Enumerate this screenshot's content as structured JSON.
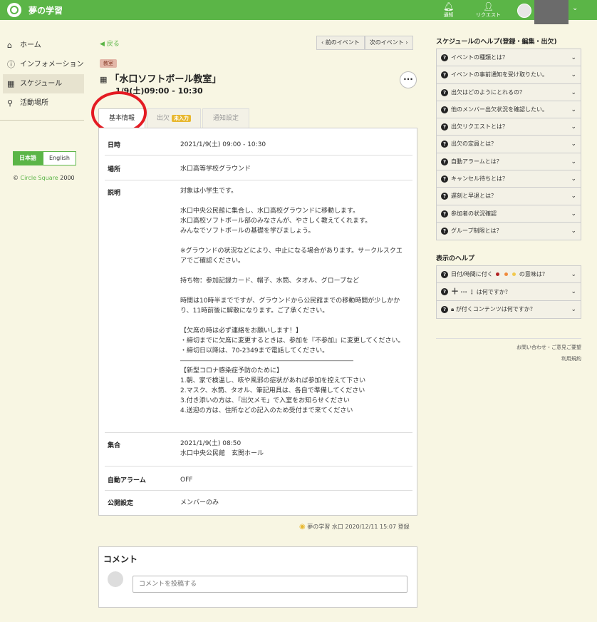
{
  "header": {
    "app_title": "夢の学習",
    "notify_label": "通知",
    "request_label": "リクエスト"
  },
  "sidebar": {
    "items": [
      {
        "label": "ホーム",
        "icon": "home-icon"
      },
      {
        "label": "インフォメーション",
        "icon": "info-icon"
      },
      {
        "label": "スケジュール",
        "icon": "calendar-icon"
      },
      {
        "label": "活動場所",
        "icon": "map-pin-icon"
      }
    ],
    "lang_ja": "日本語",
    "lang_en": "English",
    "copyright_symbol": "©",
    "copyright_brand": "Circle Square",
    "copyright_year": "2000"
  },
  "main": {
    "back_label": "戻る",
    "prev_event": "前のイベント",
    "next_event": "次のイベント",
    "category_badge": "教室",
    "title": "「水口ソフトボール教室」",
    "datetime": "1/9(土)09:00 - 10:30",
    "tabs": {
      "basic": "基本情報",
      "attendance": "出欠",
      "attendance_badge": "未入力",
      "notify": "通知設定"
    },
    "rows": [
      {
        "key": "日時",
        "value": "2021/1/9(土) 09:00 - 10:30"
      },
      {
        "key": "場所",
        "value": "水口高等学校グラウンド"
      },
      {
        "key": "説明",
        "value": "対象は小学生です。\n\n水口中央公民館に集合し、水口高校グラウンドに移動します。\n水口高校ソフトボール部のみなさんが、やさしく教えてくれます。\nみんなでソフトボールの基礎を学びましょう。\n\n※グラウンドの状況などにより、中止になる場合があります。サークルスクエアでご確認ください。\n\n持ち物：参加記録カード、帽子、水筒、タオル、グローブなど\n\n時間は10時半までですが、グラウンドから公民館までの移動時間が少しかかり、11時前後に解散になります。ご了承ください。\n\n【欠席の時は必ず連絡をお願いします！】\n・締切までに欠席に変更するときは、参加を『不参加』に変更してください。\n・締切日以降は、70-2349まで電話してください。\n―――――――――――――――――――――――――――\n【新型コロナ感染症予防のために】\n1.朝、家で検温し、咳や風邪の症状があれば参加を控えて下さい\n2.マスク、水筒、タオル、筆記用具は、各自で準備してください\n3.付き添いの方は、「出欠メモ」で入室をお知らせください\n4.送迎の方は、住所などの記入のため受付まで来てください"
      },
      {
        "key": "集合",
        "value": "2021/1/9(土) 08:50\n水口中央公民館　玄関ホール"
      },
      {
        "key": "自動アラーム",
        "value": "OFF"
      },
      {
        "key": "公開設定",
        "value": "メンバーのみ"
      }
    ],
    "creator": "夢の学習 水口",
    "created_at": "2020/12/11 15:07 登録",
    "comment_title": "コメント",
    "comment_placeholder": "コメントを投稿する"
  },
  "help": {
    "schedule_title": "スケジュールのヘルプ(登録・編集・出欠)",
    "schedule_items": [
      "イベントの種類とは？",
      "イベントの事前通知を受け取りたい。",
      "出欠はどのようにとれるの？",
      "他のメンバー出欠状況を確認したい。",
      "出欠リクエストとは？",
      "出欠の定員とは？",
      "自動アラームとは？",
      "キャンセル待ちとは？",
      "遅刻と早退とは？",
      "参加者の状況確認",
      "グループ制限とは？"
    ],
    "display_title": "表示のヘルプ",
    "display_item1_pre": "日付/時間に付く",
    "display_item1_post": "の意味は？",
    "display_item2": "は何ですか？",
    "display_item3": "が付くコンテンツは何ですか？",
    "footer_contact": "お問い合わせ・ご意見ご要望",
    "footer_terms": "利用規約",
    "colors": {
      "dot_red": "#b22222",
      "dot_orange": "#f08a3c",
      "dot_yellow": "#f2c94c"
    }
  }
}
